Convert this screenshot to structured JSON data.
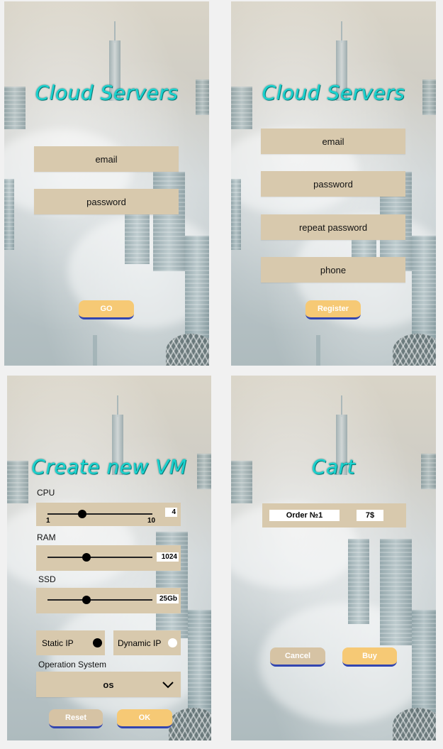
{
  "login": {
    "title": "Cloud Servers",
    "email_placeholder": "email",
    "password_placeholder": "password",
    "go_label": "GO"
  },
  "register": {
    "title": "Cloud Servers",
    "email_placeholder": "email",
    "password_placeholder": "password",
    "repeat_password_placeholder": "repeat password",
    "phone_placeholder": "phone",
    "register_label": "Register"
  },
  "create_vm": {
    "title": "Create new VM",
    "cpu": {
      "label": "CPU",
      "value": "4",
      "min_label": "1",
      "max_label": "10",
      "fraction": 0.33
    },
    "ram": {
      "label": "RAM",
      "value": "1024",
      "fraction": 0.37
    },
    "ssd": {
      "label": "SSD",
      "value": "25Gb",
      "fraction": 0.37
    },
    "static_ip_label": "Static IP",
    "dynamic_ip_label": "Dynamic IP",
    "static_ip_selected": true,
    "os_section_label": "Operation System",
    "os_value": "os",
    "reset_label": "Reset",
    "ok_label": "OK"
  },
  "cart": {
    "title": "Cart",
    "order_name": "Order №1",
    "order_price": "7$",
    "cancel_label": "Cancel",
    "buy_label": "Buy"
  },
  "colors": {
    "title": "#19d3cf",
    "field": "#d8c9ad",
    "primary_button": "#f6c975",
    "secondary_button": "#d6c3a4",
    "button_underline": "#3346b0"
  }
}
